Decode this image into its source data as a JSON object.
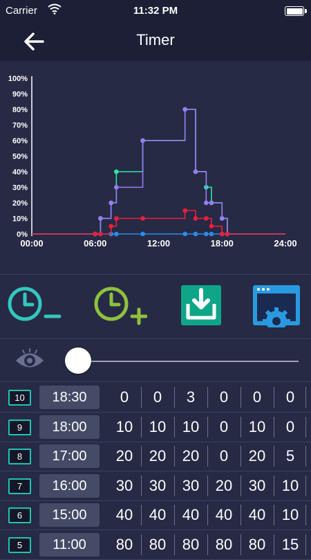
{
  "status_bar": {
    "carrier": "Carrier",
    "time": "11:32 PM"
  },
  "nav": {
    "title": "Timer"
  },
  "chart_data": {
    "type": "line",
    "step": true,
    "x_unit": "hours",
    "y_unit": "%",
    "x_ticks": [
      "00:00",
      "06:00",
      "12:00",
      "18:00",
      "24:00"
    ],
    "y_ticks": [
      "0%",
      "10%",
      "20%",
      "30%",
      "40%",
      "50%",
      "60%",
      "70%",
      "80%",
      "90%",
      "100%"
    ],
    "xlim": [
      0,
      24
    ],
    "ylim": [
      0,
      100
    ],
    "grid": false,
    "series": [
      {
        "color": "#2ee6a6",
        "points": [
          [
            6,
            0
          ],
          [
            6.5,
            10
          ],
          [
            7.5,
            20
          ],
          [
            8,
            40
          ],
          [
            10.5,
            60
          ],
          [
            14.5,
            80
          ],
          [
            15.5,
            40
          ],
          [
            16.5,
            30
          ],
          [
            17,
            20
          ],
          [
            18,
            10
          ],
          [
            18.5,
            0
          ]
        ]
      },
      {
        "color": "#9a7cf0",
        "points": [
          [
            6,
            0
          ],
          [
            6.5,
            10
          ],
          [
            7.5,
            20
          ],
          [
            8,
            30
          ],
          [
            10.5,
            60
          ],
          [
            14.5,
            80
          ],
          [
            15.5,
            40
          ],
          [
            16.5,
            20
          ],
          [
            17,
            20
          ],
          [
            18,
            10
          ],
          [
            18.5,
            0
          ]
        ]
      },
      {
        "color": "#2a8ce8",
        "points": [
          [
            6,
            0
          ],
          [
            6.5,
            0
          ],
          [
            7.5,
            0
          ],
          [
            8,
            0
          ],
          [
            10.5,
            0
          ],
          [
            14.5,
            0
          ],
          [
            15.5,
            0
          ],
          [
            16.5,
            0
          ],
          [
            17,
            0
          ],
          [
            18,
            0
          ],
          [
            18.5,
            0
          ]
        ]
      },
      {
        "color": "#e8203c",
        "points": [
          [
            6,
            0
          ],
          [
            6.5,
            0
          ],
          [
            7.5,
            5
          ],
          [
            8,
            10
          ],
          [
            10.5,
            10
          ],
          [
            14.5,
            15
          ],
          [
            15.5,
            10
          ],
          [
            16.5,
            10
          ],
          [
            17,
            5
          ],
          [
            18,
            0
          ],
          [
            18.5,
            0
          ]
        ]
      }
    ]
  },
  "actions": {
    "remove_timer": "clock-minus-icon",
    "add_timer": "clock-plus-icon",
    "save": "download-tray-icon",
    "settings": "window-gear-icon"
  },
  "preview": {
    "icon": "eye-icon",
    "slider_value": 0
  },
  "colors": {
    "accent": "#1fc4b4",
    "background": "#262a45",
    "bar": "#1c1f36"
  },
  "rows": [
    {
      "index": "10",
      "time": "18:30",
      "values": [
        "0",
        "0",
        "3",
        "0",
        "0",
        "0"
      ]
    },
    {
      "index": "9",
      "time": "18:00",
      "values": [
        "10",
        "10",
        "10",
        "0",
        "10",
        "0"
      ]
    },
    {
      "index": "8",
      "time": "17:00",
      "values": [
        "20",
        "20",
        "20",
        "0",
        "20",
        "5"
      ]
    },
    {
      "index": "7",
      "time": "16:00",
      "values": [
        "30",
        "30",
        "30",
        "20",
        "30",
        "10"
      ]
    },
    {
      "index": "6",
      "time": "15:00",
      "values": [
        "40",
        "40",
        "40",
        "40",
        "40",
        "10"
      ]
    },
    {
      "index": "5",
      "time": "11:00",
      "values": [
        "80",
        "80",
        "80",
        "80",
        "80",
        "15"
      ]
    }
  ]
}
